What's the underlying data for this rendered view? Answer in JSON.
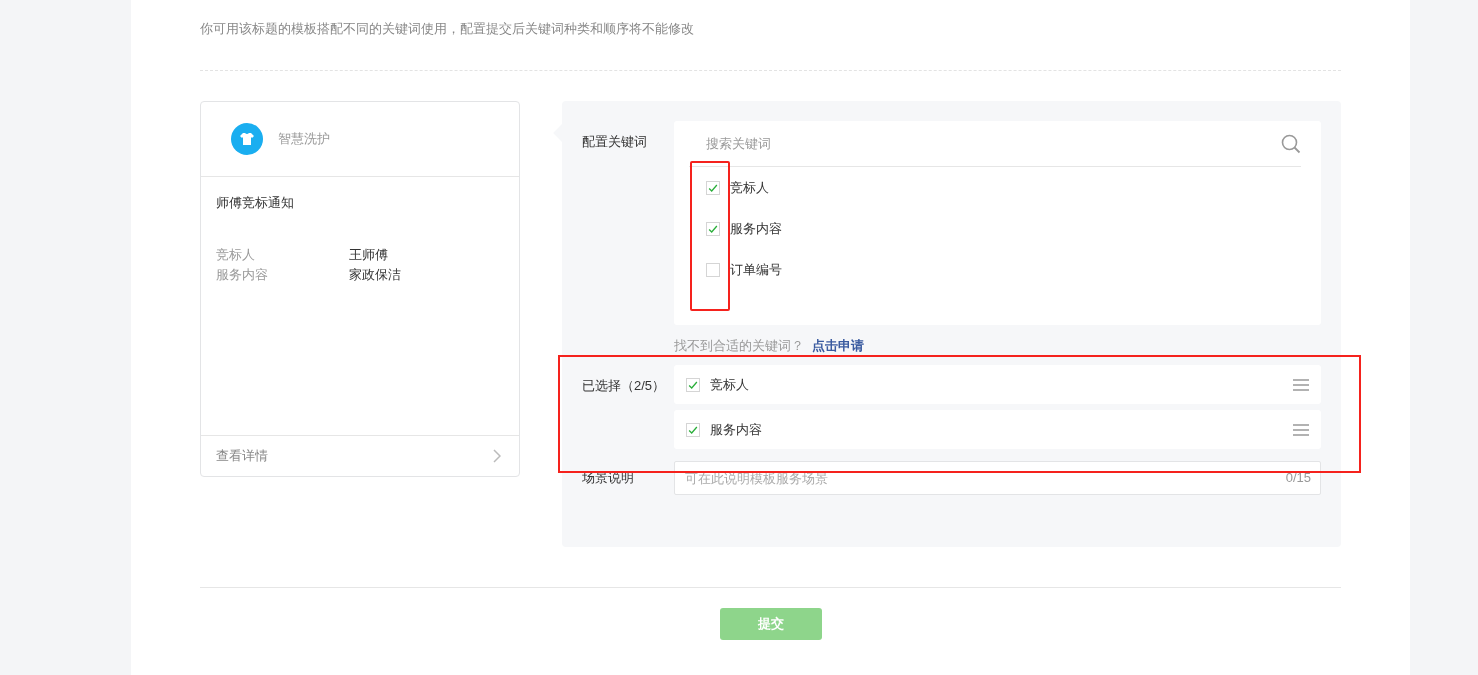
{
  "intro": "你可用该标题的模板搭配不同的关键词使用，配置提交后关键词种类和顺序将不能修改",
  "preview": {
    "account": "智慧洗护",
    "title": "师傅竞标通知",
    "fields": [
      {
        "label": "竞标人",
        "value": "王师傅"
      },
      {
        "label": "服务内容",
        "value": "家政保洁"
      }
    ],
    "detail_link": "查看详情"
  },
  "config": {
    "keywords_label": "配置关键词",
    "search": {
      "placeholder": "搜索关键词"
    },
    "keywords": [
      {
        "label": "竞标人",
        "checked": true
      },
      {
        "label": "服务内容",
        "checked": true
      },
      {
        "label": "订单编号",
        "checked": false
      }
    ],
    "help_text": "找不到合适的关键词？",
    "apply_link": "点击申请",
    "selected_label": "已选择（2/5）",
    "selected": [
      {
        "label": "竞标人",
        "checked": true
      },
      {
        "label": "服务内容",
        "checked": true
      }
    ],
    "scene_label": "场景说明",
    "scene": {
      "placeholder": "可在此说明模板服务场景",
      "counter": "0/15"
    }
  },
  "submit": {
    "label": "提交",
    "disabled": true
  }
}
